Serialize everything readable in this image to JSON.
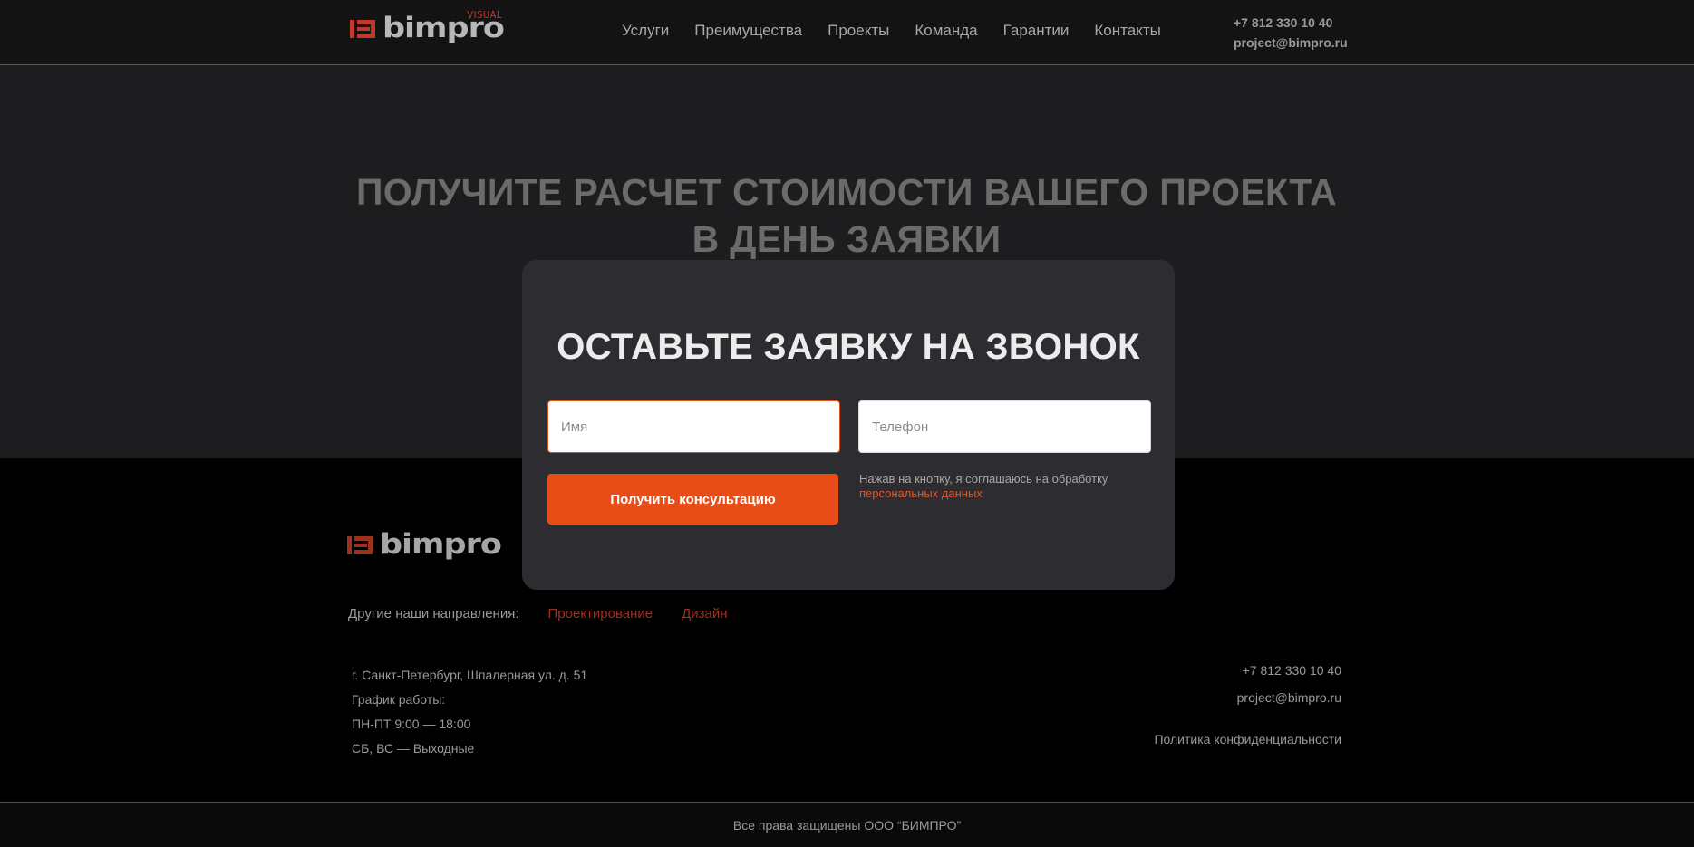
{
  "header": {
    "logo": {
      "word": "bimpro",
      "tagline": "VISUAL",
      "brand_color": "#c0392b"
    },
    "nav": [
      {
        "label": "Услуги"
      },
      {
        "label": "Преимущества"
      },
      {
        "label": "Проекты"
      },
      {
        "label": "Команда"
      },
      {
        "label": "Гарантии"
      },
      {
        "label": "Контакты"
      }
    ],
    "phone": "+7 812 330 10 40",
    "email": "project@bimpro.ru"
  },
  "hero": {
    "title": "ПОЛУЧИТЕ РАСЧЕТ СТОИМОСТИ ВАШЕГО ПРОЕКТА В ДЕНЬ ЗАЯВКИ"
  },
  "modal": {
    "title": "ОСТАВЬТЕ ЗАЯВКУ НА ЗВОНОК",
    "name_placeholder": "Имя",
    "name_value": "",
    "phone_placeholder": "Телефон",
    "phone_value": "",
    "submit_label": "Получить консультацию",
    "consent_text": "Нажав на кнопку, я соглашаюсь на обработку",
    "consent_link": "персональных данных",
    "accent_color": "#e84c17"
  },
  "footer": {
    "logo": {
      "word": "bimpro"
    },
    "directions_label": "Другие наши направления:",
    "directions": [
      {
        "label": "Проектирование"
      },
      {
        "label": "Дизайн"
      }
    ],
    "address": "г. Санкт-Петербург, Шпалерная ул. д. 51",
    "schedule_label": "График работы:",
    "schedule_weekdays": "ПН-ПТ 9:00 — 18:00",
    "schedule_weekend": "СБ, ВС — Выходные",
    "phone": "+7 812 330 10 40",
    "email": "project@bimpro.ru",
    "privacy": "Политика конфиденциальности",
    "copyright": "Все права защищены ООО “БИМПРО”"
  }
}
